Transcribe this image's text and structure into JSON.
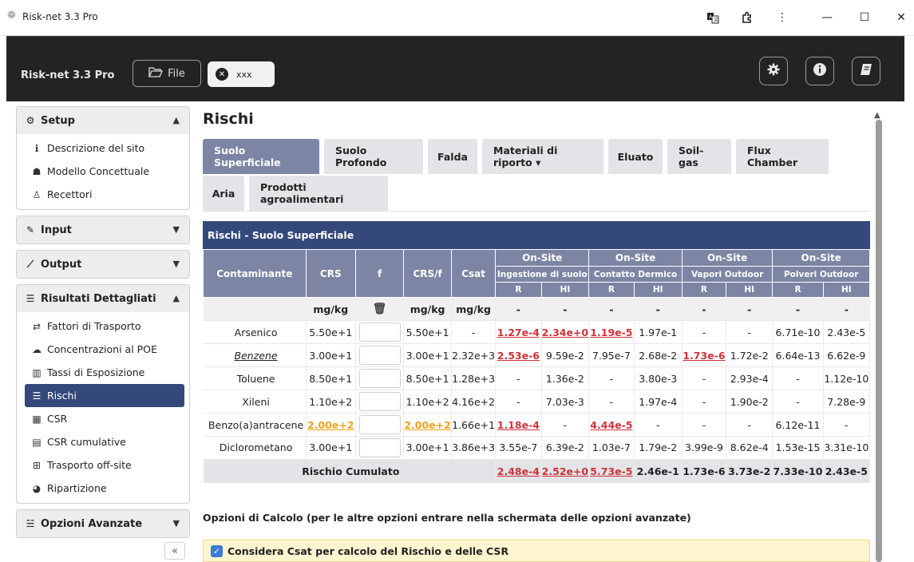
{
  "window": {
    "title": "Risk-net 3.3 Pro",
    "minimize": "—",
    "maximize": "☐",
    "close": "✕",
    "menu": "⋮"
  },
  "header": {
    "brand": "Risk-net 3.3 Pro",
    "file_label": "File",
    "project_label": "xxx"
  },
  "sidebar": {
    "setup": {
      "label": "Setup",
      "items": [
        "Descrizione del sito",
        "Modello Concettuale",
        "Recettori"
      ]
    },
    "input": {
      "label": "Input"
    },
    "output": {
      "label": "Output"
    },
    "risultati": {
      "label": "Risultati Dettagliati",
      "items": [
        "Fattori di Trasporto",
        "Concentrazioni al POE",
        "Tassi di Esposizione",
        "Rischi",
        "CSR",
        "CSR cumulative",
        "Trasporto off-site",
        "Ripartizione"
      ]
    },
    "opzioni": {
      "label": "Opzioni Avanzate"
    },
    "collapse": "«"
  },
  "main": {
    "title": "Rischi",
    "tabs_row1": [
      "Suolo Superficiale",
      "Suolo Profondo",
      "Falda",
      "Materiali di riporto ▾",
      "Eluato",
      "Soil-gas",
      "Flux Chamber"
    ],
    "tabs_row2": [
      "Aria",
      "Prodotti agroalimentari"
    ],
    "table_title": "Rischi - Suolo Superficiale",
    "headers": {
      "contaminante": "Contaminante",
      "crs": "CRS",
      "f": "f",
      "crsf": "CRS/f",
      "csat": "Csat",
      "onsite": "On-Site",
      "groups": [
        "Ingestione di suolo",
        "Contatto Dermico",
        "Vapori Outdoor",
        "Polveri Outdoor"
      ],
      "r": "R",
      "hi": "HI"
    },
    "units": [
      "mg/kg",
      "mg/kg",
      "mg/kg"
    ],
    "dash": "-",
    "rows": [
      {
        "name": "Arsenico",
        "crs": "5.50e+1",
        "crsf": "5.50e+1",
        "csat": "-",
        "v": [
          "1.27e-4",
          "2.34e+0",
          "1.19e-5",
          "1.97e-1",
          "-",
          "-",
          "6.71e-10",
          "2.43e-5"
        ]
      },
      {
        "name": "Benzene",
        "crs": "3.00e+1",
        "crsf": "3.00e+1",
        "csat": "2.32e+3",
        "v": [
          "2.53e-6",
          "9.59e-2",
          "7.95e-7",
          "2.68e-2",
          "1.73e-6",
          "1.72e-2",
          "6.64e-13",
          "6.62e-9"
        ]
      },
      {
        "name": "Toluene",
        "crs": "8.50e+1",
        "crsf": "8.50e+1",
        "csat": "1.28e+3",
        "v": [
          "-",
          "1.36e-2",
          "-",
          "3.80e-3",
          "-",
          "2.93e-4",
          "-",
          "1.12e-10"
        ]
      },
      {
        "name": "Xileni",
        "crs": "1.10e+2",
        "crsf": "1.10e+2",
        "csat": "4.16e+2",
        "v": [
          "-",
          "7.03e-3",
          "-",
          "1.97e-4",
          "-",
          "1.90e-2",
          "-",
          "7.28e-9"
        ]
      },
      {
        "name": "Benzo(a)antracene",
        "crs": "2.00e+2",
        "crsf": "2.00e+2",
        "csat": "1.66e+1",
        "v": [
          "1.18e-4",
          "-",
          "4.44e-5",
          "-",
          "-",
          "-",
          "6.12e-11",
          "-"
        ]
      },
      {
        "name": "Diclorometano",
        "crs": "3.00e+1",
        "crsf": "3.00e+1",
        "csat": "3.86e+3",
        "v": [
          "3.55e-7",
          "6.39e-2",
          "1.03e-7",
          "1.79e-2",
          "3.99e-9",
          "8.62e-4",
          "1.53e-15",
          "3.31e-10"
        ]
      }
    ],
    "cumulative": {
      "label": "Rischio Cumulato",
      "v": [
        "2.48e-4",
        "2.52e+0",
        "5.73e-5",
        "2.46e-1",
        "1.73e-6",
        "3.73e-2",
        "7.33e-10",
        "2.43e-5"
      ]
    },
    "calc_options_label": "Opzioni di Calcolo (per le altre opzioni entrare nella schermata delle opzioni avanzate)",
    "csat_option": "Considera Csat per calcolo del Rischio e delle CSR"
  },
  "colors": {
    "accent": "#34497a",
    "header_bg": "#7c85a3",
    "exceed": "#d0323a",
    "warning": "#f0a21d"
  }
}
